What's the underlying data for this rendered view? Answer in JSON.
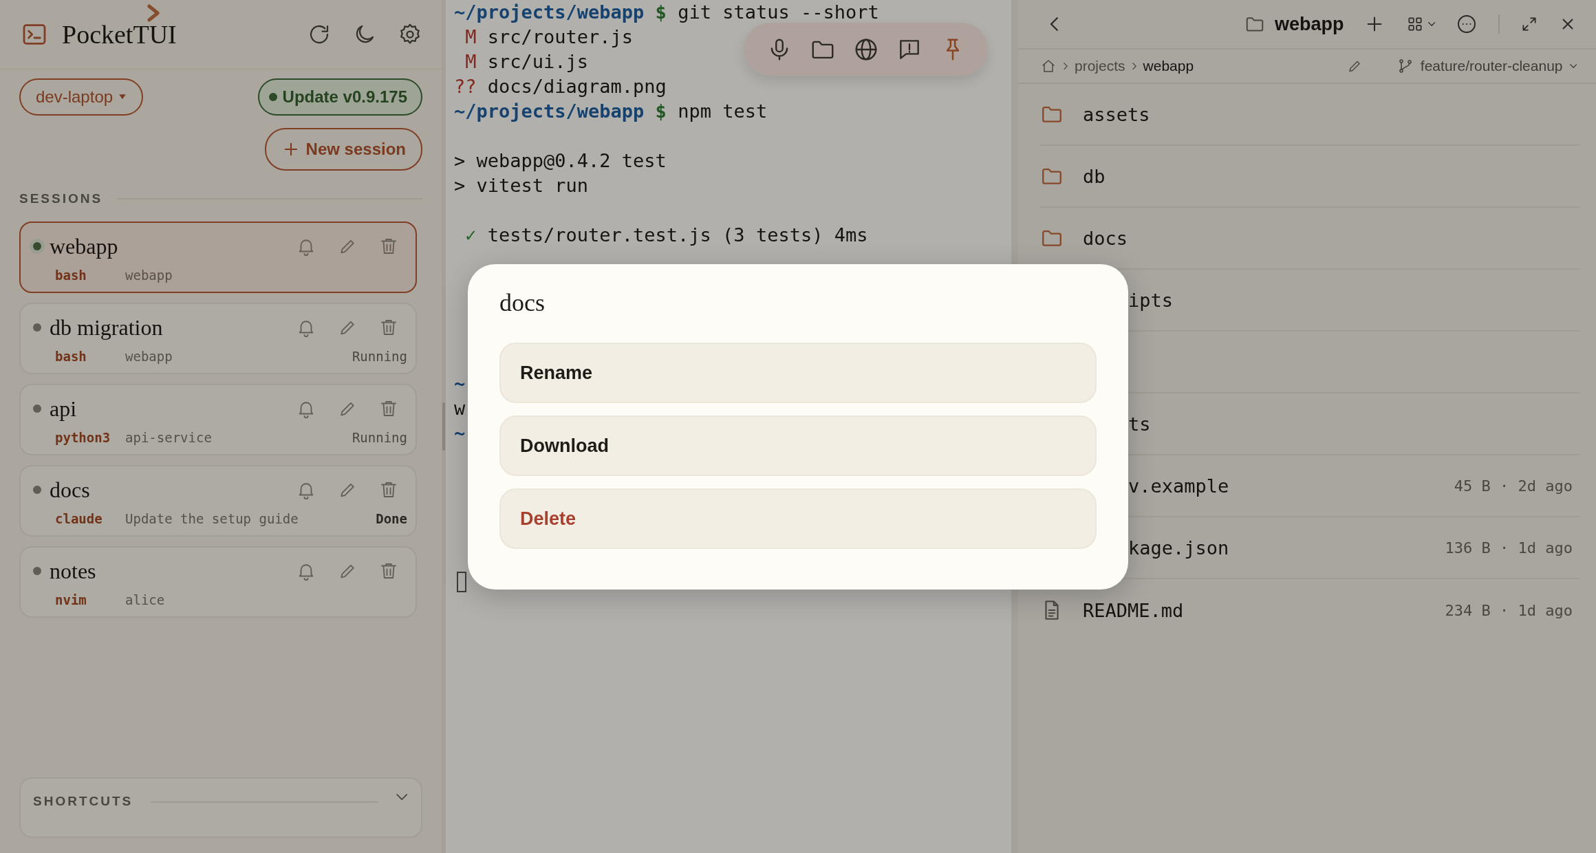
{
  "app": {
    "title": "PocketTUI"
  },
  "sidebar": {
    "host": "dev-laptop",
    "update": "Update v0.9.175",
    "new_session": "New session",
    "sessions_label": "SESSIONS",
    "sessions": [
      {
        "name": "webapp",
        "command": "bash",
        "detail": "webapp",
        "selected": true,
        "active": true
      },
      {
        "name": "db migration",
        "command": "bash",
        "detail": "webapp",
        "status": "Running",
        "emphasized": false,
        "selected": false,
        "active": false
      },
      {
        "name": "api",
        "command": "python3",
        "detail": "api-service",
        "status": "Running",
        "emphasized": false,
        "selected": false,
        "active": false
      },
      {
        "name": "docs",
        "command": "claude",
        "detail": "Update the setup guide",
        "status": "Done",
        "emphasized": true,
        "selected": false,
        "active": false
      },
      {
        "name": "notes",
        "command": "nvim",
        "detail": "alice",
        "selected": false,
        "active": false
      }
    ],
    "shortcuts": {
      "label": "SHORTCUTS",
      "expanded": false
    }
  },
  "terminal": {
    "lines": [
      {
        "kind": "prompt",
        "path": "~/projects/webapp",
        "symbol": "$",
        "command": "git status --short"
      },
      {
        "kind": "change",
        "mark": "M",
        "text": "src/router.js"
      },
      {
        "kind": "change",
        "mark": "M",
        "text": "src/ui.js"
      },
      {
        "kind": "change",
        "mark": "??",
        "text": "docs/diagram.png"
      },
      {
        "kind": "prompt",
        "path": "~/projects/webapp",
        "symbol": "$",
        "command": "npm test"
      },
      {
        "kind": "blank"
      },
      {
        "kind": "plain",
        "text": "> webapp@0.4.2 test"
      },
      {
        "kind": "plain",
        "text": "> vitest run"
      },
      {
        "kind": "blank"
      },
      {
        "kind": "pass",
        "mark": "✓",
        "text": "tests/router.test.js (3 tests) 4ms"
      },
      {
        "kind": "blank"
      },
      {
        "kind": "blank"
      },
      {
        "kind": "blank"
      },
      {
        "kind": "blank"
      },
      {
        "kind": "blank"
      },
      {
        "kind": "path",
        "text": "~"
      },
      {
        "kind": "plain",
        "text": "w"
      },
      {
        "kind": "path",
        "text": "~"
      },
      {
        "kind": "blank"
      },
      {
        "kind": "blank"
      },
      {
        "kind": "blank"
      },
      {
        "kind": "blank"
      },
      {
        "kind": "blank"
      },
      {
        "kind": "cursor"
      }
    ],
    "toolbar": {
      "pinned": true
    }
  },
  "files": {
    "title": "webapp",
    "breadcrumb": [
      "projects",
      "webapp"
    ],
    "branch": "feature/router-cleanup",
    "entries": [
      {
        "kind": "folder",
        "name": "assets"
      },
      {
        "kind": "folder",
        "name": "db"
      },
      {
        "kind": "folder",
        "name": "docs"
      },
      {
        "kind": "partial",
        "name": "ipts"
      },
      {
        "kind": "covered"
      },
      {
        "kind": "partial",
        "name": "ts"
      },
      {
        "kind": "partial",
        "name": "v.example",
        "meta": "45 B · 2d ago"
      },
      {
        "kind": "partial",
        "name": "kage.json",
        "meta": "136 B · 1d ago"
      },
      {
        "kind": "file",
        "name": "README.md",
        "meta": "234 B · 1d ago"
      }
    ]
  },
  "dialog": {
    "title": "docs",
    "actions": [
      {
        "label": "Rename",
        "kind": "normal"
      },
      {
        "label": "Download",
        "kind": "normal"
      },
      {
        "label": "Delete",
        "kind": "danger"
      }
    ]
  }
}
